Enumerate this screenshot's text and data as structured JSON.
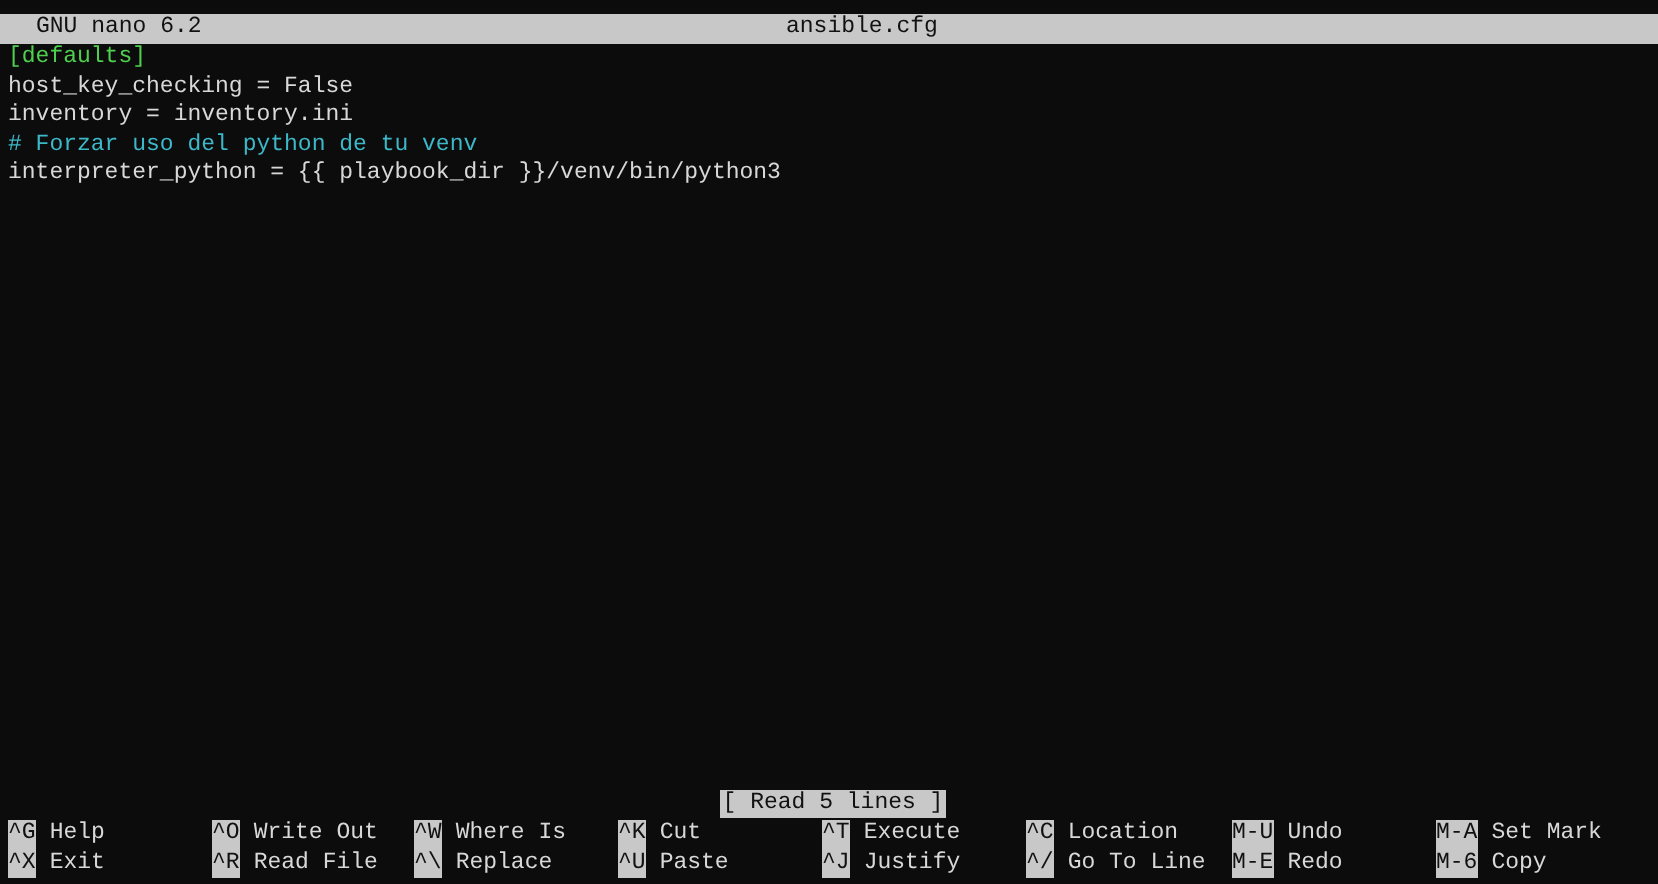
{
  "title_bar": {
    "program": "GNU nano 6.2",
    "filename": "ansible.cfg"
  },
  "lines": [
    {
      "kind": "section",
      "text": "[defaults]"
    },
    {
      "kind": "plain",
      "text": "host_key_checking = False"
    },
    {
      "kind": "plain",
      "text": "inventory = inventory.ini"
    },
    {
      "kind": "comment",
      "text": "# Forzar uso del python de tu venv"
    },
    {
      "kind": "plain",
      "text": "interpreter_python = {{ playbook_dir }}/venv/bin/python3"
    }
  ],
  "status_message": "[ Read 5 lines ]",
  "shortcuts": [
    [
      {
        "key": "^G",
        "label": "Help"
      },
      {
        "key": "^O",
        "label": "Write Out"
      },
      {
        "key": "^W",
        "label": "Where Is"
      },
      {
        "key": "^K",
        "label": "Cut"
      },
      {
        "key": "^T",
        "label": "Execute"
      },
      {
        "key": "^C",
        "label": "Location"
      },
      {
        "key": "M-U",
        "label": "Undo"
      },
      {
        "key": "M-A",
        "label": "Set Mark"
      }
    ],
    [
      {
        "key": "^X",
        "label": "Exit"
      },
      {
        "key": "^R",
        "label": "Read File"
      },
      {
        "key": "^\\",
        "label": "Replace"
      },
      {
        "key": "^U",
        "label": "Paste"
      },
      {
        "key": "^J",
        "label": "Justify"
      },
      {
        "key": "^/",
        "label": "Go To Line"
      },
      {
        "key": "M-E",
        "label": "Redo"
      },
      {
        "key": "M-6",
        "label": "Copy"
      }
    ]
  ]
}
